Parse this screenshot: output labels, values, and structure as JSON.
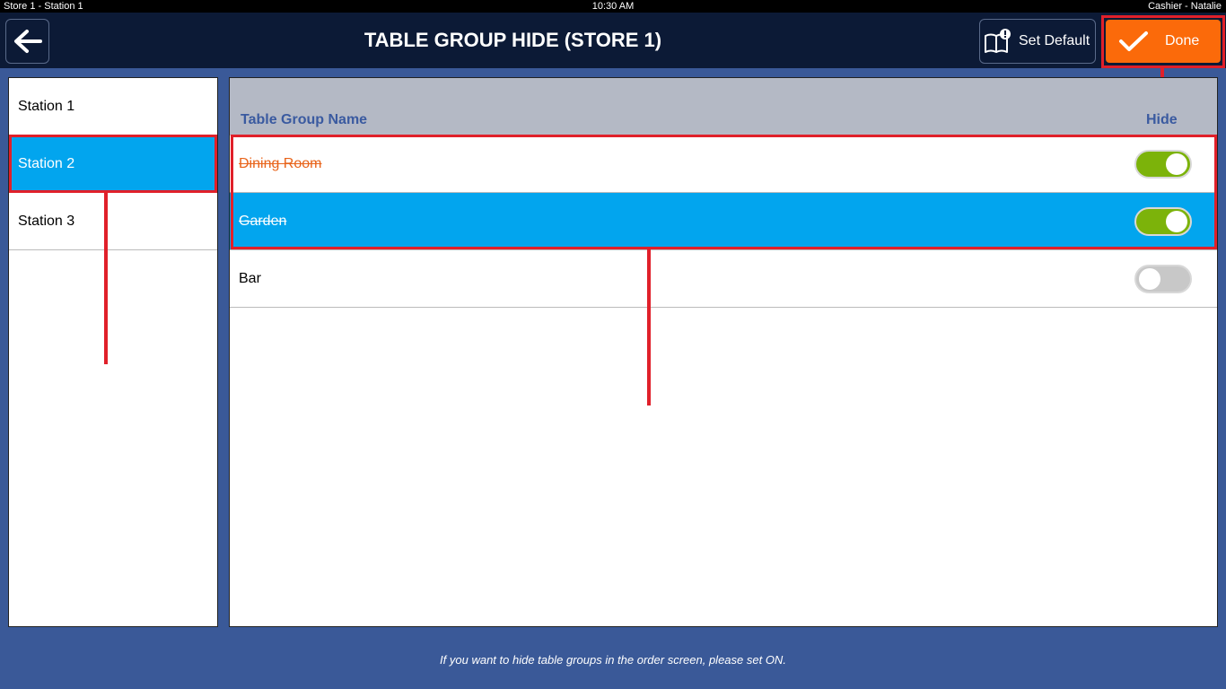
{
  "statusbar": {
    "left": "Store 1 - Station 1",
    "time": "10:30 AM",
    "user": "Cashier - Natalie"
  },
  "header": {
    "title": "TABLE GROUP HIDE (STORE 1)",
    "set_default": "Set Default",
    "done": "Done"
  },
  "stations": [
    {
      "label": "Station 1",
      "selected": false
    },
    {
      "label": "Station 2",
      "selected": true
    },
    {
      "label": "Station 3",
      "selected": false
    }
  ],
  "table": {
    "col_name": "Table Group Name",
    "col_hide": "Hide",
    "rows": [
      {
        "name": "Dining Room",
        "hide": true,
        "selected": false
      },
      {
        "name": "Garden",
        "hide": true,
        "selected": true
      },
      {
        "name": "Bar",
        "hide": false,
        "selected": false
      }
    ]
  },
  "footer": {
    "hint": "If you want to hide table groups in the order screen, please set ON."
  },
  "colors": {
    "header_bg": "#0c1a36",
    "page_bg": "#3a5998",
    "selected": "#02a5ee",
    "done": "#fb6a0a",
    "toggle_on": "#7cb30a",
    "highlight": "#e0202a"
  }
}
